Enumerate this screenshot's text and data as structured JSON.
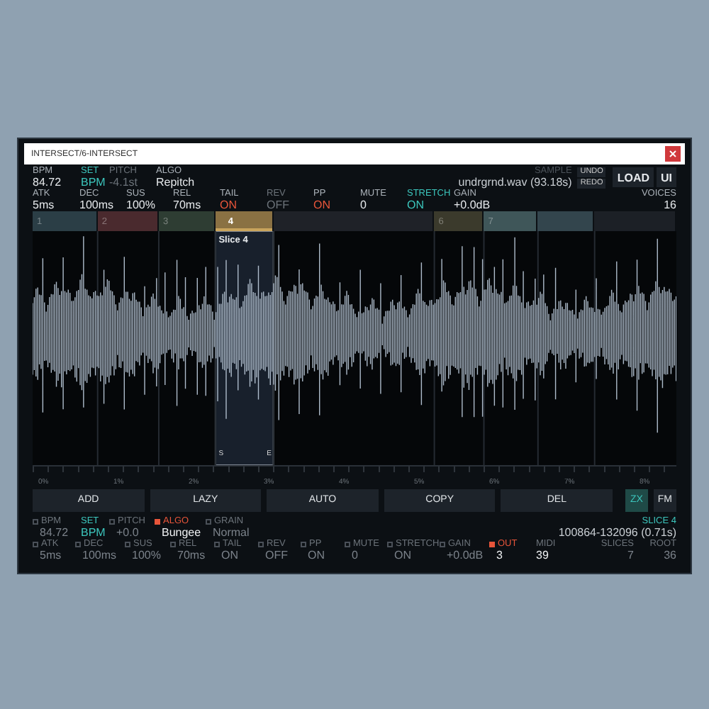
{
  "window": {
    "title": "INTERSECT/6-INTERSECT"
  },
  "top_params": [
    {
      "label": "BPM",
      "value": "84.72",
      "kind": "plain"
    },
    {
      "label": "SET",
      "value": "BPM",
      "kind": "accent"
    },
    {
      "label": "PITCH",
      "value": "-4.1st",
      "kind": "dim"
    },
    {
      "label": "ALGO",
      "value": "Repitch",
      "kind": "plain"
    }
  ],
  "sample": {
    "label": "SAMPLE",
    "file": "undrgrnd.wav (93.18s)"
  },
  "history_buttons": [
    "UNDO",
    "REDO"
  ],
  "buttons": [
    "LOAD",
    "UI"
  ],
  "envelope_params": [
    {
      "label": "ATK",
      "value": "5ms",
      "kind": "plain"
    },
    {
      "label": "DEC",
      "value": "100ms",
      "kind": "plain"
    },
    {
      "label": "SUS",
      "value": "100%",
      "kind": "plain"
    },
    {
      "label": "REL",
      "value": "70ms",
      "kind": "plain"
    },
    {
      "label": "TAIL",
      "value": "ON",
      "kind": "alert"
    },
    {
      "label": "REV",
      "value": "OFF",
      "kind": "dim"
    },
    {
      "label": "PP",
      "value": "ON",
      "kind": "alert"
    },
    {
      "label": "MUTE",
      "value": "0",
      "kind": "plain"
    },
    {
      "label": "STRETCH",
      "value": "ON",
      "kind": "accent"
    },
    {
      "label": "GAIN",
      "value": "+0.0dB",
      "kind": "plain"
    }
  ],
  "voices": {
    "label": "VOICES",
    "value": "16"
  },
  "slices": [
    {
      "label": "1",
      "color": "#2b3e46",
      "selected": false
    },
    {
      "label": "2",
      "color": "#4a2a2e",
      "selected": false
    },
    {
      "label": "3",
      "color": "#2e3d33",
      "selected": false
    },
    {
      "label": "4",
      "color": "#8a7143",
      "selected": true
    },
    {
      "color": "#1f2228",
      "selected": false
    },
    {
      "label": "6",
      "color": "#3b3a2c",
      "selected": false
    },
    {
      "label": "7",
      "color": "#3f5659",
      "selected": false
    },
    {
      "color": "#33454d",
      "selected": false
    },
    {
      "color": "#1c2026",
      "selected": false
    }
  ],
  "waveform": {
    "selection_label": "Slice 4",
    "start_marker": "S",
    "end_marker": "E"
  },
  "ruler": [
    "0%",
    "1%",
    "2%",
    "3%",
    "4%",
    "5%",
    "6%",
    "7%",
    "8%"
  ],
  "actions": [
    "ADD",
    "LAZY",
    "AUTO",
    "COPY",
    "DEL"
  ],
  "modes": [
    {
      "label": "ZX",
      "selected": true
    },
    {
      "label": "FM",
      "selected": false
    }
  ],
  "slice_params": [
    {
      "label": "BPM",
      "value": "84.72",
      "kind": "check",
      "checked": false
    },
    {
      "label": "SET",
      "value": "BPM",
      "kind": "accent"
    },
    {
      "label": "PITCH",
      "value": "+0.0",
      "kind": "check",
      "checked": false
    },
    {
      "label": "ALGO",
      "value": "Bungee",
      "kind": "check",
      "checked": true
    },
    {
      "label": "GRAIN",
      "value": "Normal",
      "kind": "check",
      "checked": false
    }
  ],
  "slice_info": {
    "label": "SLICE 4",
    "range": "100864-132096 (0.71s)"
  },
  "slice_envelope": [
    {
      "label": "ATK",
      "value": "5ms",
      "kind": "check",
      "checked": false
    },
    {
      "label": "DEC",
      "value": "100ms",
      "kind": "check",
      "checked": false
    },
    {
      "label": "SUS",
      "value": "100%",
      "kind": "check",
      "checked": false
    },
    {
      "label": "REL",
      "value": "70ms",
      "kind": "check",
      "checked": false
    },
    {
      "label": "TAIL",
      "value": "ON",
      "kind": "check",
      "checked": false
    },
    {
      "label": "REV",
      "value": "OFF",
      "kind": "check",
      "checked": false
    },
    {
      "label": "PP",
      "value": "ON",
      "kind": "check",
      "checked": false
    },
    {
      "label": "MUTE",
      "value": "0",
      "kind": "check",
      "checked": false
    },
    {
      "label": "STRETCH",
      "value": "ON",
      "kind": "check",
      "checked": false
    },
    {
      "label": "GAIN",
      "value": "+0.0dB",
      "kind": "check",
      "checked": false
    },
    {
      "label": "OUT",
      "value": "3",
      "kind": "check",
      "checked": true
    },
    {
      "label": "MIDI",
      "value": "39",
      "kind": "plain"
    }
  ],
  "slice_totals": [
    {
      "label": "SLICES",
      "value": "7"
    },
    {
      "label": "ROOT",
      "value": "36"
    }
  ]
}
